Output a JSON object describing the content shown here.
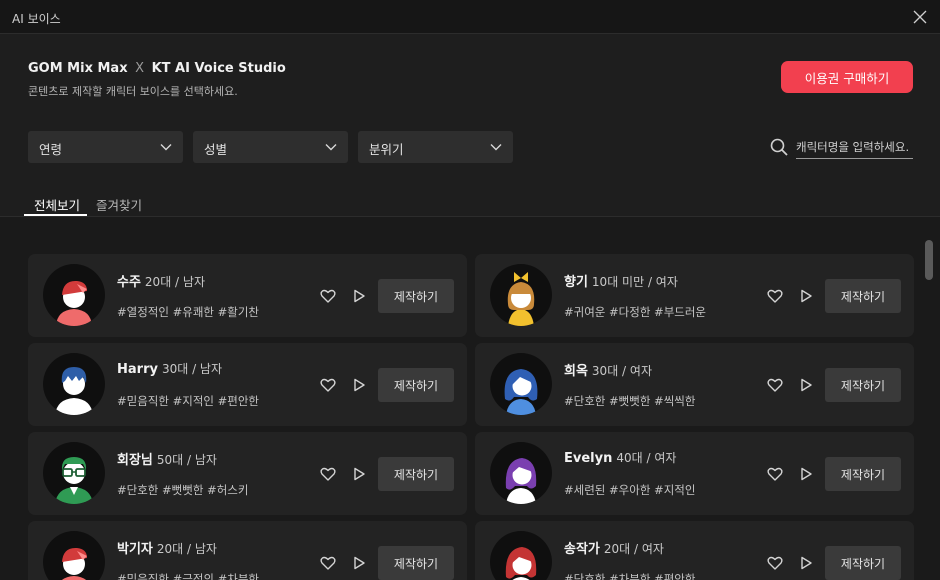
{
  "window": {
    "title": "AI 보이스"
  },
  "header": {
    "brand_left": "GOM Mix Max",
    "brand_x": "X",
    "brand_right": "KT AI Voice Studio",
    "subtitle": "콘텐츠로 제작할 캐릭터 보이스를 선택하세요.",
    "buy_button": "이용권 구매하기"
  },
  "filters": {
    "age": "연령",
    "gender": "성별",
    "mood": "분위기"
  },
  "search": {
    "placeholder": "캐릭터명을 입력하세요."
  },
  "tabs": {
    "all": "전체보기",
    "favorites": "즐겨찾기"
  },
  "action_label": "제작하기",
  "characters": [
    {
      "name": "수주",
      "meta": "20대 / 남자",
      "tags": "#열정적인 #유쾌한 #활기찬",
      "avatar": "red-cap"
    },
    {
      "name": "향기",
      "meta": "10대 미만 / 여자",
      "tags": "#귀여운 #다정한 #부드러운",
      "avatar": "yellow-bow"
    },
    {
      "name": "Harry",
      "meta": "30대 / 남자",
      "tags": "#믿음직한 #지적인 #편안한",
      "avatar": "blue-hair"
    },
    {
      "name": "희옥",
      "meta": "30대 / 여자",
      "tags": "#단호한 #뻣뻣한 #씩씩한",
      "avatar": "blue-long-hair"
    },
    {
      "name": "회장님",
      "meta": "50대 / 남자",
      "tags": "#단호한 #뻣뻣한 #허스키",
      "avatar": "green-glasses"
    },
    {
      "name": "Evelyn",
      "meta": "40대 / 여자",
      "tags": "#세련된 #우아한 #지적인",
      "avatar": "purple-hair"
    },
    {
      "name": "박기자",
      "meta": "20대 / 남자",
      "tags": "#믿음직한 #긍정의 #차분한",
      "avatar": "red-cap"
    },
    {
      "name": "송작가",
      "meta": "20대 / 여자",
      "tags": "#단호한 #차분한 #편안한",
      "avatar": "red-hair"
    }
  ],
  "colors": {
    "accent": "#f2404f",
    "background": "#1e1e1e",
    "card": "#232323",
    "button": "#3a3a3a"
  }
}
